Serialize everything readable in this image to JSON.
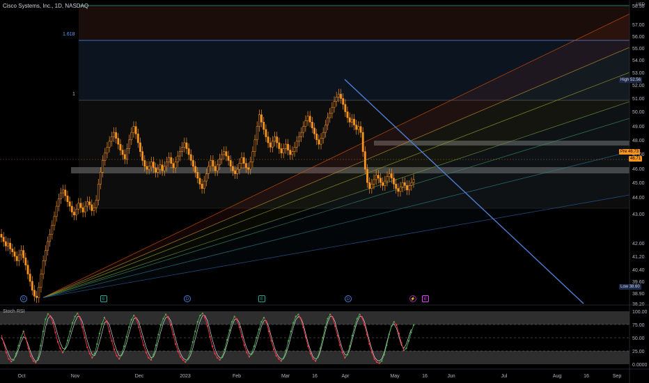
{
  "header": {
    "symbol_title": "Cisco Systems, Inc., 1D, NASDAQ",
    "currency": "USD",
    "indicator_title": "Stoch RSI"
  },
  "fib_labels": {
    "upper": "1.618",
    "mid": "1"
  },
  "badges": {
    "high_label": "High",
    "high_value": "52.56",
    "pre_label": "Pre",
    "pre_value": "46.73",
    "last_value": "46.71",
    "low_label": "Low",
    "low_value": "38.60"
  },
  "markers": [
    {
      "letter": "D",
      "kind": "dividend"
    },
    {
      "letter": "E",
      "kind": "earnings"
    },
    {
      "letter": "D",
      "kind": "dividend"
    },
    {
      "letter": "E",
      "kind": "earnings"
    },
    {
      "letter": "D",
      "kind": "dividend"
    },
    {
      "letter": "⚡",
      "kind": "split"
    },
    {
      "letter": "E",
      "kind": "earnings"
    }
  ],
  "chart_data": [
    {
      "type": "candlestick",
      "title": "Cisco Systems, Inc., 1D, NASDAQ",
      "y_unit": "USD",
      "ylim": [
        38.2,
        58.5
      ],
      "y_ticks": [
        "58.50",
        "57.00",
        "56.00",
        "55.00",
        "54.00",
        "53.00",
        "52.00",
        "51.00",
        "50.00",
        "49.00",
        "48.00",
        "47.00",
        "46.00",
        "45.00",
        "44.00",
        "43.00",
        "42.00",
        "41.20",
        "40.40",
        "39.60",
        "38.90",
        "38.20"
      ],
      "x_ticks": [
        "Oct",
        "Nov",
        "Dec",
        "2023",
        "Feb",
        "Mar",
        "16",
        "Apr",
        "May",
        "16",
        "Jun",
        "Jul",
        "Aug",
        "16",
        "Sep"
      ],
      "close_series": [
        42.8,
        42.5,
        42.2,
        42.4,
        42.0,
        41.8,
        41.5,
        41.2,
        41.6,
        41.9,
        41.4,
        40.9,
        40.3,
        39.8,
        39.2,
        38.8,
        38.7,
        39.4,
        40.3,
        41.2,
        41.9,
        42.5,
        43.0,
        43.6,
        44.2,
        44.9,
        45.4,
        45.8,
        46.0,
        45.6,
        45.2,
        44.9,
        44.5,
        44.3,
        44.7,
        45.1,
        44.8,
        44.5,
        44.9,
        45.2,
        45.0,
        44.6,
        44.8,
        45.3,
        46.4,
        47.2,
        48.0,
        48.5,
        48.9,
        49.3,
        49.6,
        49.9,
        49.5,
        49.1,
        48.7,
        48.4,
        48.1,
        48.8,
        49.4,
        49.9,
        50.3,
        49.8,
        49.2,
        48.6,
        48.0,
        47.6,
        47.4,
        47.6,
        47.9,
        47.5,
        47.2,
        47.4,
        47.7,
        47.3,
        47.6,
        47.9,
        48.2,
        47.8,
        47.5,
        47.9,
        48.3,
        48.6,
        48.9,
        49.2,
        48.8,
        48.4,
        48.0,
        47.6,
        47.2,
        46.8,
        46.4,
        46.1,
        46.6,
        47.1,
        47.6,
        48.0,
        47.6,
        47.3,
        47.7,
        48.1,
        48.4,
        48.6,
        48.3,
        48.0,
        47.6,
        47.3,
        47.1,
        47.4,
        47.8,
        48.2,
        47.8,
        47.5,
        47.4,
        47.9,
        48.6,
        49.4,
        50.3,
        51.1,
        50.6,
        50.1,
        49.6,
        49.2,
        48.9,
        49.3,
        49.6,
        49.2,
        48.8,
        48.5,
        48.8,
        49.1,
        48.7,
        48.4,
        48.6,
        48.9,
        49.3,
        49.6,
        49.9,
        50.3,
        50.7,
        51.0,
        50.6,
        50.2,
        49.8,
        49.4,
        49.1,
        49.5,
        49.9,
        50.4,
        50.9,
        51.2,
        51.6,
        52.0,
        52.3,
        52.5,
        52.2,
        51.8,
        51.3,
        50.9,
        50.6,
        50.8,
        50.4,
        50.1,
        50.3,
        49.9,
        48.6,
        47.4,
        46.5,
        46.1,
        46.4,
        46.7,
        47.0,
        46.8,
        46.5,
        46.3,
        46.6,
        46.9,
        47.1,
        46.8,
        46.4,
        46.1,
        45.9,
        46.2,
        46.5,
        46.3,
        46.0,
        46.3,
        46.5,
        46.71
      ],
      "stoch_rsi": {
        "ylim": [
          0,
          100
        ],
        "y_ticks": [
          "100.00",
          "75.00",
          "50.00",
          "25.00",
          "0.0000"
        ],
        "k": [
          55,
          40,
          22,
          10,
          5,
          8,
          20,
          35,
          50,
          62,
          48,
          30,
          15,
          6,
          3,
          12,
          35,
          62,
          85,
          95,
          90,
          78,
          60,
          42,
          30,
          22,
          30,
          45,
          62,
          78,
          90,
          96,
          88,
          70,
          50,
          32,
          20,
          12,
          20,
          38,
          58,
          76,
          88,
          80,
          62,
          44,
          28,
          16,
          10,
          18,
          34,
          52,
          70,
          84,
          92,
          86,
          70,
          52,
          36,
          22,
          12,
          8,
          18,
          36,
          56,
          74,
          86,
          94,
          88,
          74,
          56,
          38,
          24,
          14,
          8,
          4,
          10,
          24,
          42,
          62,
          80,
          92,
          96,
          88,
          72,
          52,
          34,
          20,
          12,
          8,
          14,
          28,
          46,
          64,
          80,
          90,
          84,
          70,
          52,
          36,
          22,
          14,
          20,
          34,
          50,
          66,
          80,
          88,
          80,
          62,
          44,
          28,
          16,
          10,
          6,
          12,
          26,
          44,
          62,
          78,
          90,
          94,
          86,
          70,
          52,
          34,
          20,
          10,
          6,
          14,
          30,
          50,
          70,
          86,
          94,
          88,
          72,
          54,
          36,
          22,
          12,
          18,
          34,
          54,
          72,
          86,
          94,
          88,
          74,
          56,
          38,
          22,
          10,
          4,
          2,
          6,
          18,
          36,
          56,
          72,
          80,
          74,
          58,
          40,
          26,
          30,
          44,
          60,
          74
        ],
        "d": [
          50,
          42,
          30,
          18,
          9,
          9,
          16,
          28,
          42,
          52,
          48,
          36,
          22,
          11,
          5,
          8,
          22,
          45,
          70,
          86,
          92,
          85,
          72,
          55,
          40,
          30,
          28,
          36,
          50,
          66,
          80,
          90,
          90,
          80,
          62,
          44,
          30,
          18,
          16,
          26,
          42,
          60,
          78,
          82,
          74,
          58,
          40,
          26,
          16,
          16,
          26,
          40,
          58,
          74,
          86,
          88,
          80,
          64,
          48,
          32,
          20,
          12,
          14,
          26,
          44,
          62,
          78,
          88,
          90,
          82,
          66,
          48,
          32,
          20,
          12,
          8,
          8,
          16,
          30,
          48,
          66,
          82,
          92,
          92,
          82,
          64,
          46,
          30,
          18,
          12,
          12,
          22,
          38,
          56,
          72,
          84,
          86,
          78,
          62,
          44,
          30,
          20,
          18,
          26,
          40,
          56,
          72,
          82,
          82,
          70,
          52,
          36,
          22,
          14,
          10,
          10,
          20,
          34,
          52,
          70,
          84,
          90,
          88,
          76,
          58,
          40,
          26,
          14,
          10,
          12,
          24,
          42,
          62,
          80,
          90,
          90,
          80,
          62,
          44,
          28,
          18,
          18,
          28,
          46,
          64,
          80,
          90,
          90,
          80,
          62,
          44,
          28,
          14,
          8,
          6,
          10,
          22,
          40,
          58,
          72,
          76,
          68,
          52,
          36,
          30,
          38,
          52,
          66
        ]
      }
    }
  ],
  "colors": {
    "candle": "#f7941d",
    "background": "#000000",
    "axis_text": "#b2b5be",
    "trendline": "#4d7fd6",
    "fib_line": "#4a90ff",
    "stoch_k_up": "#4caf50",
    "stoch_k_down": "#f23645",
    "stoch_d": "#d1d4dc"
  }
}
